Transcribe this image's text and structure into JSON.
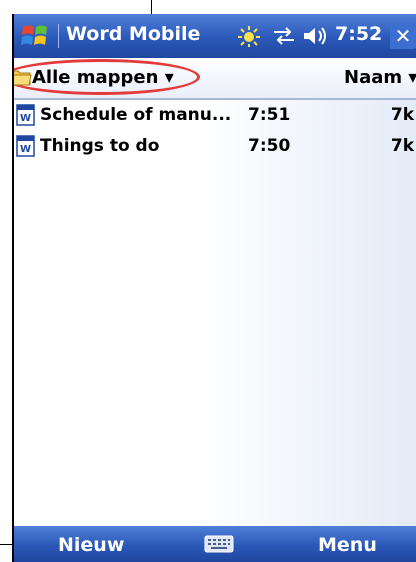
{
  "titlebar": {
    "app_title": "Word Mobile",
    "clock": "7:52",
    "close_glyph": "✕",
    "icons": [
      "start-icon",
      "notification-icon",
      "connectivity-icon",
      "volume-icon"
    ]
  },
  "folderbar": {
    "folder_label": "Alle mappen ▾",
    "sort_label": "Naam ▾"
  },
  "files": [
    {
      "name": "Schedule of manu...",
      "time": "7:51",
      "size": "7k"
    },
    {
      "name": "Things to do",
      "time": "7:50",
      "size": "7k"
    }
  ],
  "menubar": {
    "left_softkey": "Nieuw",
    "right_softkey": "Menu"
  },
  "colors": {
    "bar_blue": "#2b58b8",
    "highlight_red": "#e13b3b"
  }
}
